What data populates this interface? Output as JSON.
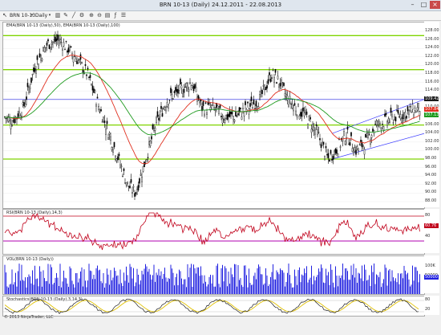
{
  "window": {
    "title": "BRN 10-13 (Daily)  24.12.2011 - 22.08.2013"
  },
  "toolbar": {
    "instrument": "BRN 10-13",
    "interval": "Daily"
  },
  "price_panel": {
    "title": "EMA(BRN 10-13 (Daily),50), EMA(BRN 10-13 (Daily),100)",
    "scale": [
      "128.00",
      "126.00",
      "124.00",
      "122.00",
      "120.00",
      "118.00",
      "116.00",
      "114.00",
      "112.00",
      "110.00",
      "108.00",
      "106.00",
      "104.00",
      "102.00",
      "100.00",
      "98.00",
      "96.00",
      "94.00",
      "92.00",
      "90.00",
      "88.00"
    ],
    "last_price": "109.42",
    "ema50_tag": "107.84",
    "ema100_tag": "107.13"
  },
  "rsi_panel": {
    "title": "RSI(BRN 10-13 (Daily),14,3)",
    "scale": [
      "80",
      "40"
    ],
    "tag": "60.76"
  },
  "vol_panel": {
    "title": "VOL(BRN 10-13 (Daily))",
    "scale": [
      "100K",
      "50000"
    ],
    "tag": "50000"
  },
  "stoch_panel": {
    "title": "Stochastics(BRN 10-13 (Daily),3,14,3)",
    "scale": [
      "80",
      "20"
    ]
  },
  "copyright": "© 2013 NinjaTrader, LLC",
  "colors": {
    "ema50": "#e03020",
    "ema100": "#1e9a1e",
    "horizontal_levels": "#7fd400",
    "rsi": "#c0001a",
    "rsi_bands": "#b000b0",
    "volume": "#2020e0",
    "stoch_k": "#202020",
    "stoch_d": "#e0c000",
    "channel": "#4040ff"
  }
}
